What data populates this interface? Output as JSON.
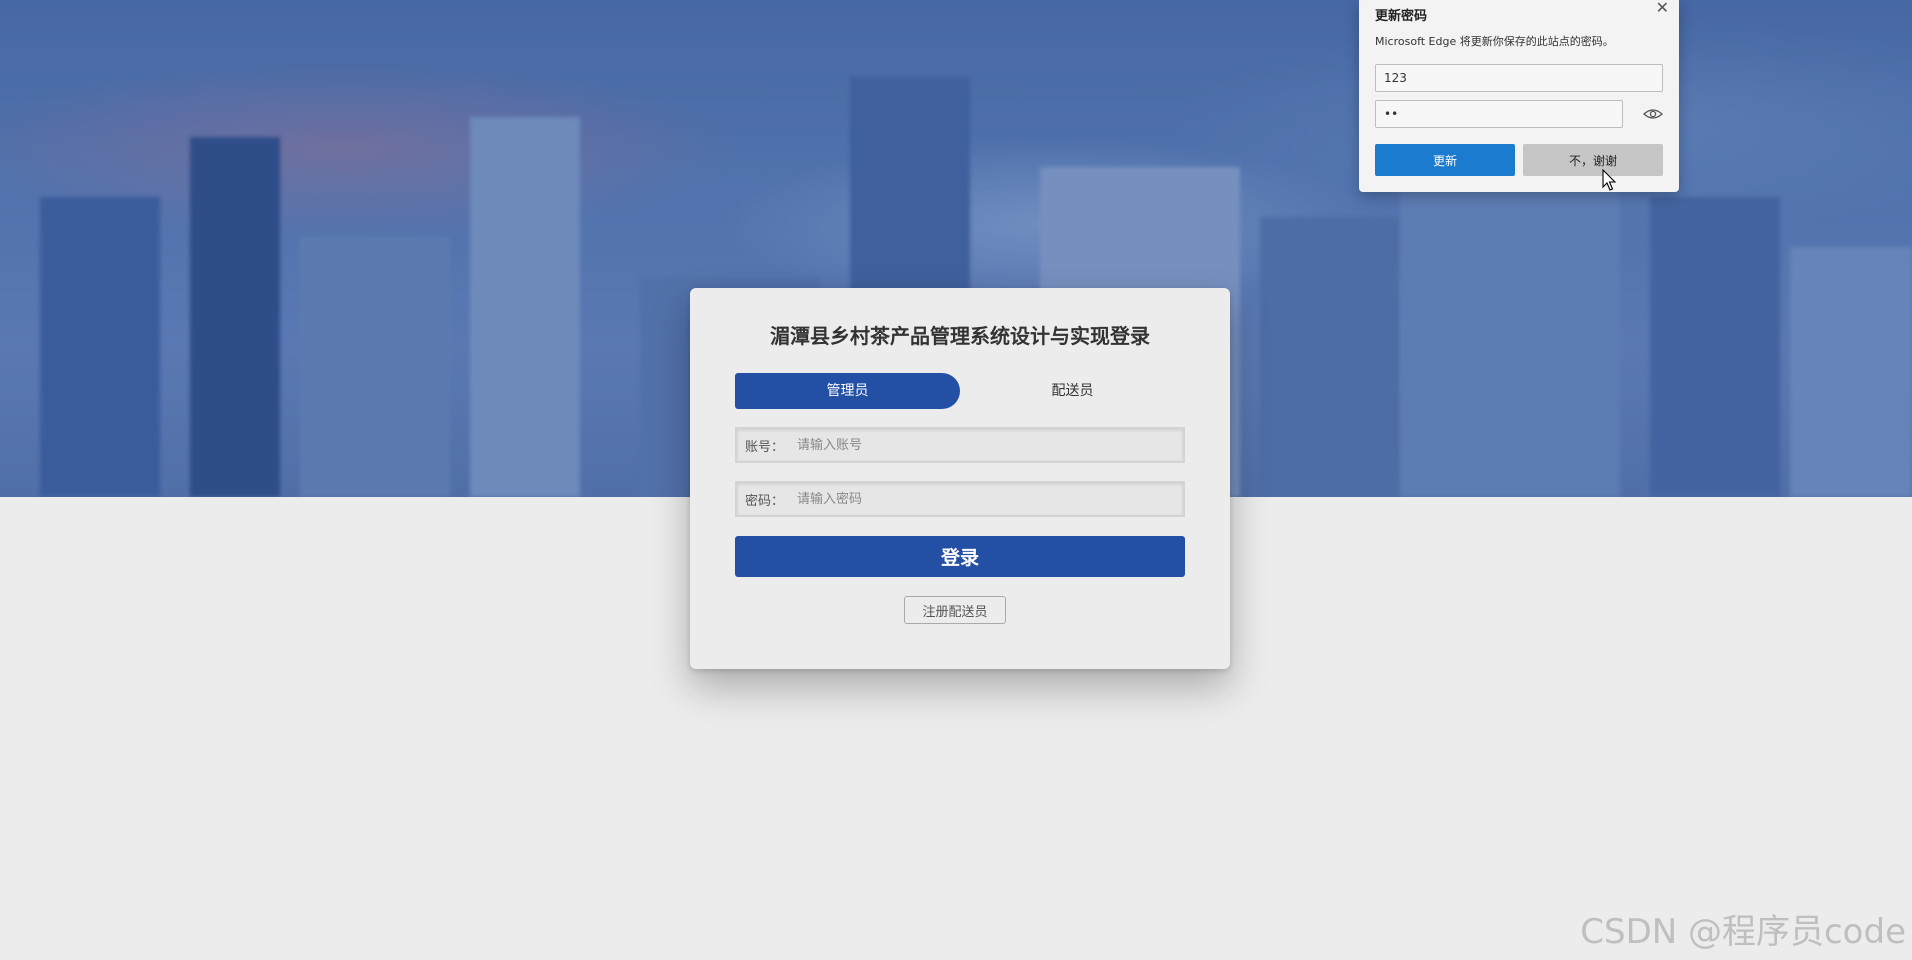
{
  "login": {
    "title": "湄潭县乡村茶产品管理系统设计与实现登录",
    "tabs": [
      {
        "label": "管理员",
        "active": true
      },
      {
        "label": "配送员",
        "active": false
      }
    ],
    "account_label": "账号：",
    "account_placeholder": "请输入账号",
    "password_label": "密码：",
    "password_placeholder": "请输入密码",
    "login_button": "登录",
    "register_button": "注册配送员"
  },
  "edge_popup": {
    "title": "更新密码",
    "description": "Microsoft Edge 将更新你保存的此站点的密码。",
    "username_value": "123",
    "password_value": "••",
    "update_button": "更新",
    "decline_button": "不，谢谢"
  },
  "watermark": "CSDN @程序员code",
  "colors": {
    "primary": "#234fa5",
    "edge_accent": "#1b7bce",
    "page_background": "#ececec"
  }
}
